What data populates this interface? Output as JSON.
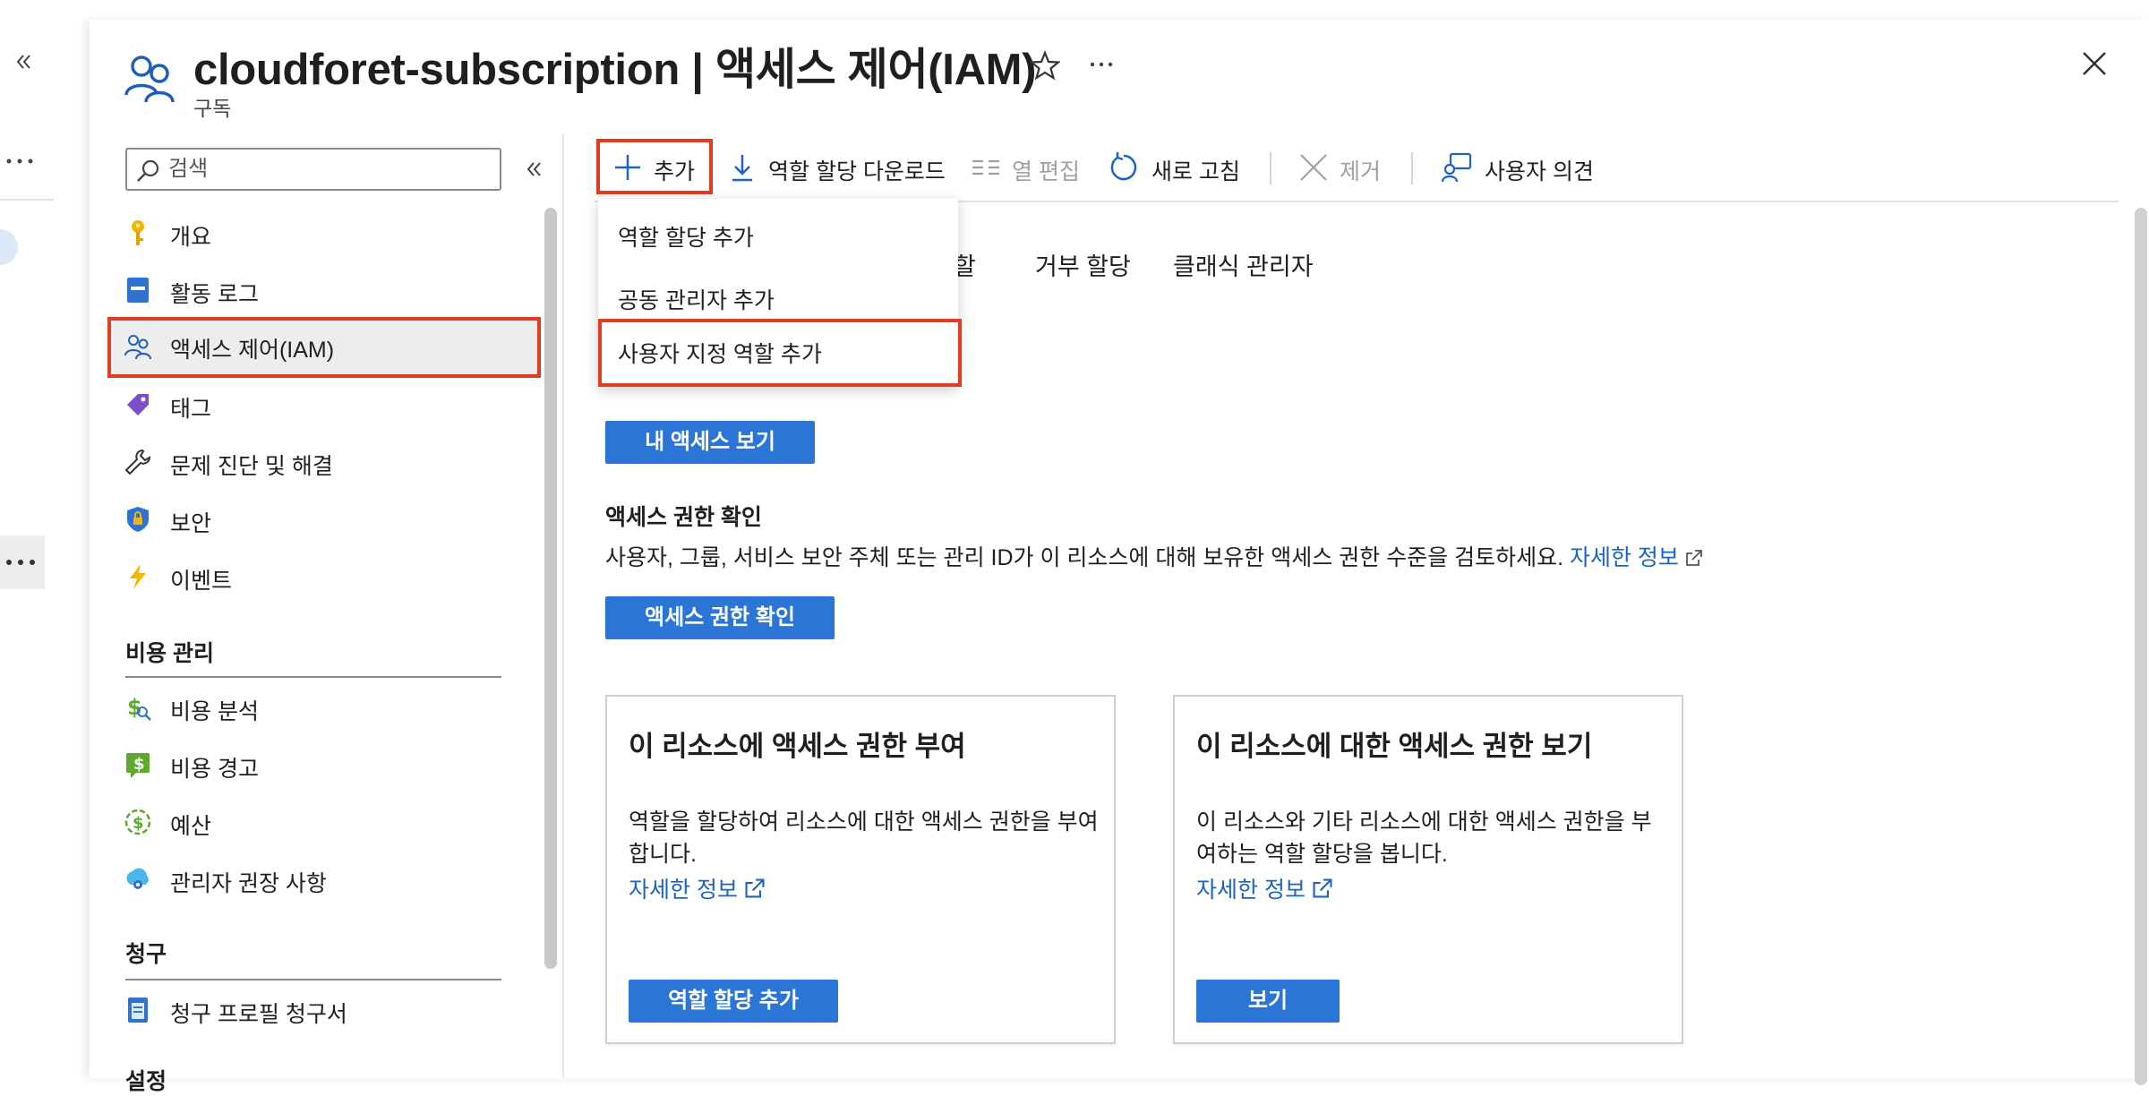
{
  "header": {
    "title": "cloudforet-subscription | 액세스 제어(IAM)",
    "subtitle": "구독",
    "favorite_icon": "star-icon",
    "more_icon": "ellipsis-icon",
    "close_icon": "close-icon"
  },
  "search": {
    "placeholder": "검색"
  },
  "sidebar": {
    "items": [
      {
        "label": "개요",
        "icon": "key-icon"
      },
      {
        "label": "활동 로그",
        "icon": "log-icon"
      },
      {
        "label": "액세스 제어(IAM)",
        "icon": "people-icon",
        "selected": true
      },
      {
        "label": "태그",
        "icon": "tag-icon"
      },
      {
        "label": "문제 진단 및 해결",
        "icon": "wrench-icon"
      },
      {
        "label": "보안",
        "icon": "shield-icon"
      },
      {
        "label": "이벤트",
        "icon": "lightning-icon"
      }
    ],
    "cost_section": {
      "title": "비용 관리",
      "items": [
        {
          "label": "비용 분석",
          "icon": "cost-analysis-icon"
        },
        {
          "label": "비용 경고",
          "icon": "cost-alert-icon"
        },
        {
          "label": "예산",
          "icon": "budget-icon"
        },
        {
          "label": "관리자 권장 사항",
          "icon": "advisor-icon"
        }
      ]
    },
    "billing_section": {
      "title": "청구",
      "items": [
        {
          "label": "청구 프로필 청구서",
          "icon": "invoice-icon"
        }
      ]
    },
    "next_section_title": "설정"
  },
  "toolbar": {
    "add": "추가",
    "download": "역할 할당 다운로드",
    "edit_columns": "열 편집",
    "refresh": "새로 고침",
    "remove": "제거",
    "feedback": "사용자 의견"
  },
  "add_menu": {
    "items": [
      "역할 할당 추가",
      "공동 관리자 추가",
      "사용자 지정 역할 추가"
    ]
  },
  "tabs": [
    "역할",
    "거부 할당",
    "클래식 관리자"
  ],
  "main": {
    "my_access_button": "내 액세스 보기",
    "check_access_title": "액세스 권한 확인",
    "check_access_text": "사용자, 그룹, 서비스 보안 주체 또는 관리 ID가 이 리소스에 대해 보유한 액세스 권한 수준을 검토하세요.",
    "learn_more": "자세한 정보",
    "check_access_button": "액세스 권한 확인"
  },
  "cards": [
    {
      "title": "이 리소스에 액세스 권한 부여",
      "desc": "역할을 할당하여 리소스에 대한 액세스 권한을 부여합니다.",
      "link": "자세한 정보",
      "button": "역할 할당 추가"
    },
    {
      "title": "이 리소스에 대한 액세스 권한 보기",
      "desc": "이 리소스와 기타 리소스에 대한 액세스 권한을 부여하는 역할 할당을 봅니다.",
      "link": "자세한 정보",
      "button": "보기"
    }
  ],
  "colors": {
    "accent": "#2b75d6",
    "highlight": "#e13d25",
    "link": "#1a64c4"
  }
}
